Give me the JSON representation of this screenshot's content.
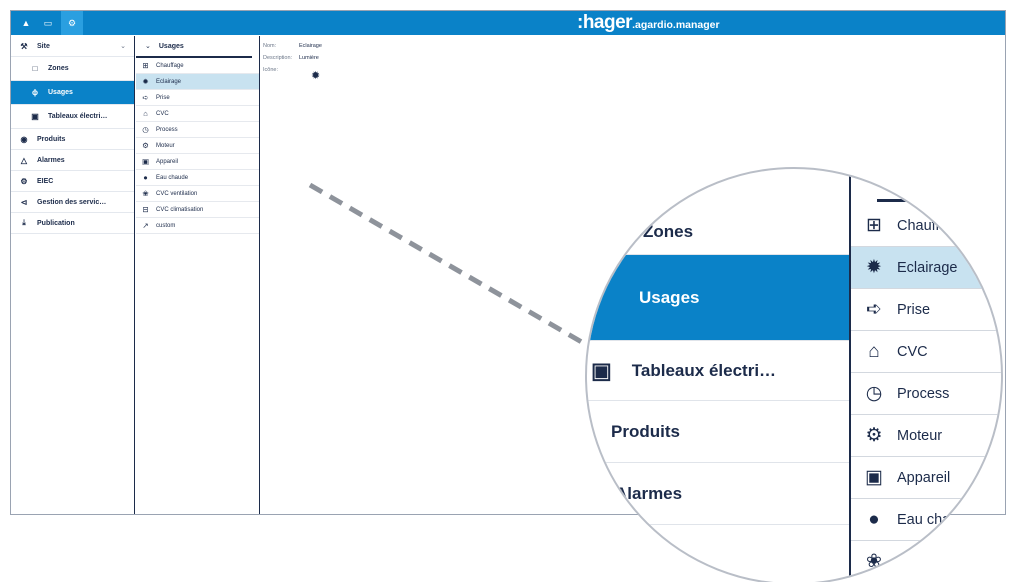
{
  "topbar": {
    "icons": [
      "home-icon",
      "monitor-icon",
      "gears-icon"
    ],
    "brand_logo": ":hager",
    "brand_sub": ".agardio.manager",
    "color": "#0a82c8"
  },
  "sidebar": {
    "items": [
      {
        "label": "Site",
        "icon": "wrench-icon",
        "expandable": true
      },
      {
        "label": "Zones",
        "icon": "zones-icon"
      },
      {
        "label": "Usages",
        "icon": "bolt-icon",
        "active": true
      },
      {
        "label": "Tableaux électri…",
        "icon": "board-icon"
      },
      {
        "label": "Produits",
        "icon": "box-icon"
      },
      {
        "label": "Alarmes",
        "icon": "bell-icon"
      },
      {
        "label": "EIEC",
        "icon": "gears-icon"
      },
      {
        "label": "Gestion des servic…",
        "icon": "share-icon"
      },
      {
        "label": "Publication",
        "icon": "upload-icon"
      }
    ]
  },
  "usages": {
    "header": "Usages",
    "items": [
      {
        "label": "Chauffage",
        "icon": "radiator-icon"
      },
      {
        "label": "Eclairage",
        "icon": "lightbulb-icon",
        "active": true
      },
      {
        "label": "Prise",
        "icon": "plug-icon"
      },
      {
        "label": "CVC",
        "icon": "house-icon"
      },
      {
        "label": "Process",
        "icon": "clock-icon"
      },
      {
        "label": "Moteur",
        "icon": "motor-icon"
      },
      {
        "label": "Appareil",
        "icon": "washer-icon"
      },
      {
        "label": "Eau chaude",
        "icon": "drop-icon"
      },
      {
        "label": "CVC ventilation",
        "icon": "fan-icon"
      },
      {
        "label": "CVC climatisation",
        "icon": "ac-icon"
      },
      {
        "label": "custom",
        "icon": "tool-icon"
      }
    ]
  },
  "details": {
    "name_label": "Nom:",
    "name_value": "Eclairage",
    "description_label": "Description:",
    "description_value": "Lumière",
    "icon_label": "Icône:",
    "icon_value": "lightbulb-icon"
  },
  "magnifier": {
    "sidebar": [
      {
        "label": "Zones"
      },
      {
        "label": "Usages",
        "active": true
      },
      {
        "label": "Tableaux électri…"
      },
      {
        "label": "Produits"
      },
      {
        "label": "Alarmes"
      }
    ],
    "list": [
      {
        "label": "Chauffage"
      },
      {
        "label": "Eclairage",
        "active": true
      },
      {
        "label": "Prise"
      },
      {
        "label": "CVC"
      },
      {
        "label": "Process"
      },
      {
        "label": "Moteur"
      },
      {
        "label": "Appareil"
      },
      {
        "label": "Eau chaude"
      },
      {
        "label": "CVC ventilation"
      }
    ]
  }
}
